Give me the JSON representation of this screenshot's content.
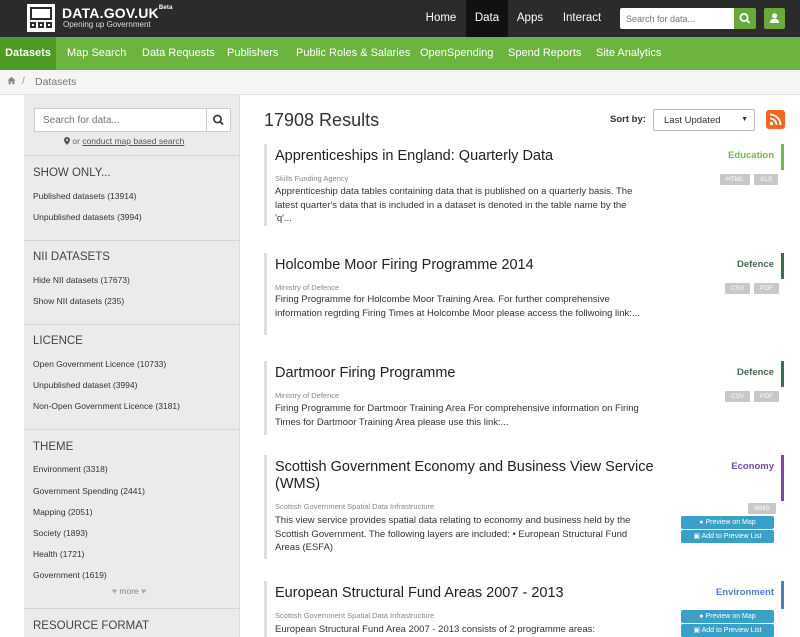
{
  "header": {
    "logo_title": "DATA.GOV.UK",
    "logo_beta": "Beta",
    "logo_subtitle": "Opening up Government",
    "nav": [
      {
        "label": "Home"
      },
      {
        "label": "Data",
        "active": true
      },
      {
        "label": "Apps"
      },
      {
        "label": "Interact"
      }
    ],
    "search_placeholder": "Search for data...",
    "search_icon": "search-icon",
    "user_icon": "user-icon"
  },
  "subnav": {
    "items": [
      {
        "label": "Datasets",
        "active": true
      },
      {
        "label": "Map Search"
      },
      {
        "label": "Data Requests"
      },
      {
        "label": "Publishers"
      },
      {
        "label": "Public Roles & Salaries"
      },
      {
        "label": "OpenSpending"
      },
      {
        "label": "Spend Reports"
      },
      {
        "label": "Site Analytics"
      }
    ]
  },
  "breadcrumb": {
    "home_icon": "home-icon",
    "separator": "/",
    "current": "Datasets"
  },
  "sidebar": {
    "search_placeholder": "Search for data...",
    "map_prefix": "or",
    "map_link": "conduct map based search",
    "facets": [
      {
        "title": "SHOW ONLY...",
        "items": [
          "Published datasets (13914)",
          "Unpublished datasets (3994)"
        ]
      },
      {
        "title": "NII DATASETS",
        "items": [
          "Hide NII datasets (17673)",
          "Show NII datasets (235)"
        ]
      },
      {
        "title": "LICENCE",
        "items": [
          "Open Government Licence (10733)",
          "Unpublished dataset (3994)",
          "Non-Open Government Licence (3181)"
        ]
      },
      {
        "title": "THEME",
        "items": [
          "Environment (3318)",
          "Government Spending (2441)",
          "Mapping (2051)",
          "Society (1893)",
          "Health (1721)",
          "Government (1619)"
        ]
      },
      {
        "title": "RESOURCE FORMAT",
        "items": []
      }
    ],
    "more_label": "more"
  },
  "main": {
    "results_title": "17908 Results",
    "sort_label": "Sort by:",
    "sort_value": "Last Updated",
    "rss_icon": "rss-icon"
  },
  "colors": {
    "education": "#7ab648",
    "defence": "#3f6b4f",
    "economy": "#7b4a9e",
    "environment": "#4a7fc1",
    "green": "#6db33f",
    "dark": "#2b2b2b"
  },
  "results": [
    {
      "title": "Apprenticeships in England: Quarterly Data",
      "publisher": "Skills Funding Agency",
      "description": "Apprenticeship data tables containing data that is published on a quarterly basis. The latest quarter's data that is included in a dataset is denoted in the table name by the 'q'...",
      "theme": "Education",
      "formats": [
        "HTML",
        "XLS"
      ],
      "buttons": []
    },
    {
      "title": "Holcombe Moor Firing Programme 2014",
      "publisher": "Ministry of Defence",
      "description": "Firing Programme for Holcombe Moor Training Area. For further comprehensive information regrding Firing Times at Holcombe Moor please access the follwoing link:...",
      "theme": "Defence",
      "formats": [
        "CSV",
        "PDF"
      ],
      "buttons": []
    },
    {
      "title": "Dartmoor Firing Programme",
      "publisher": "Ministry of Defence",
      "description": "Firing Programme for Dartmoor Training Area For comprehensive information on Firing Times for Dartmoor Training Area please use this link:...",
      "theme": "Defence",
      "formats": [
        "CSV",
        "PDF"
      ],
      "buttons": []
    },
    {
      "title": "Scottish Government Economy and Business View Service (WMS)",
      "publisher": "Scottish Government Spatial Data Infrastructure",
      "description": "This view service provides spatial data relating to economy and business held by the Scottish Government. The following layers are included: • European Structural Fund Areas (ESFA)",
      "theme": "Economy",
      "formats": [
        "WMS"
      ],
      "buttons": [
        "Preview on Map",
        "Add to Preview List"
      ]
    },
    {
      "title": "European Structural Fund Areas 2007 - 2013",
      "publisher": "Scottish Government Spatial Data Infrastructure",
      "description": "European Structural Fund Area 2007 - 2013 consists of 2 programme areas:",
      "theme": "Environment",
      "formats": [],
      "buttons": [
        "Preview on Map",
        "Add to Preview List"
      ]
    }
  ]
}
